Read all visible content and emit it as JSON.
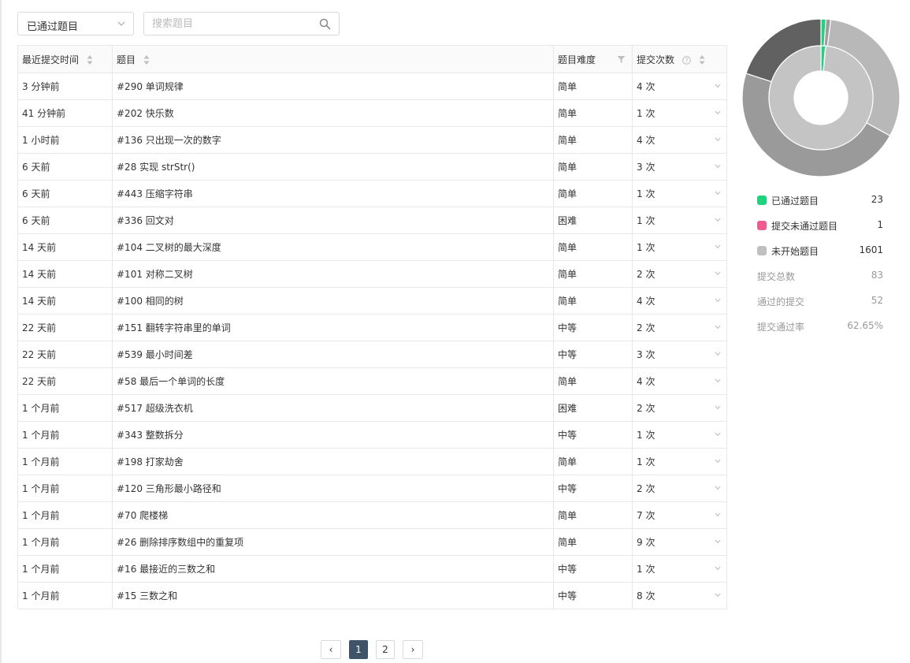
{
  "filter": {
    "selected": "已通过题目"
  },
  "search": {
    "placeholder": "搜索题目"
  },
  "table": {
    "headers": {
      "time": "最近提交时间",
      "title": "题目",
      "difficulty": "题目难度",
      "count": "提交次数"
    },
    "rows": [
      {
        "time": "3 分钟前",
        "title": "#290 单词规律",
        "difficulty": "简单",
        "level": "easy",
        "count": "4 次"
      },
      {
        "time": "41 分钟前",
        "title": "#202 快乐数",
        "difficulty": "简单",
        "level": "easy",
        "count": "1 次"
      },
      {
        "time": "1 小时前",
        "title": "#136 只出现一次的数字",
        "difficulty": "简单",
        "level": "easy",
        "count": "4 次"
      },
      {
        "time": "6 天前",
        "title": "#28 实现 strStr()",
        "difficulty": "简单",
        "level": "easy",
        "count": "3 次"
      },
      {
        "time": "6 天前",
        "title": "#443 压缩字符串",
        "difficulty": "简单",
        "level": "easy",
        "count": "1 次"
      },
      {
        "time": "6 天前",
        "title": "#336 回文对",
        "difficulty": "困难",
        "level": "hard",
        "count": "1 次"
      },
      {
        "time": "14 天前",
        "title": "#104 二叉树的最大深度",
        "difficulty": "简单",
        "level": "easy",
        "count": "1 次"
      },
      {
        "time": "14 天前",
        "title": "#101 对称二叉树",
        "difficulty": "简单",
        "level": "easy",
        "count": "2 次"
      },
      {
        "time": "14 天前",
        "title": "#100 相同的树",
        "difficulty": "简单",
        "level": "easy",
        "count": "4 次"
      },
      {
        "time": "22 天前",
        "title": "#151 翻转字符串里的单词",
        "difficulty": "中等",
        "level": "mid",
        "count": "2 次"
      },
      {
        "time": "22 天前",
        "title": "#539 最小时间差",
        "difficulty": "中等",
        "level": "mid",
        "count": "3 次"
      },
      {
        "time": "22 天前",
        "title": "#58 最后一个单词的长度",
        "difficulty": "简单",
        "level": "easy",
        "count": "4 次"
      },
      {
        "time": "1 个月前",
        "title": "#517 超级洗衣机",
        "difficulty": "困难",
        "level": "hard",
        "count": "2 次"
      },
      {
        "time": "1 个月前",
        "title": "#343 整数拆分",
        "difficulty": "中等",
        "level": "mid",
        "count": "1 次"
      },
      {
        "time": "1 个月前",
        "title": "#198 打家劫舍",
        "difficulty": "简单",
        "level": "easy",
        "count": "1 次"
      },
      {
        "time": "1 个月前",
        "title": "#120 三角形最小路径和",
        "difficulty": "中等",
        "level": "mid",
        "count": "2 次"
      },
      {
        "time": "1 个月前",
        "title": "#70 爬楼梯",
        "difficulty": "简单",
        "level": "easy",
        "count": "7 次"
      },
      {
        "time": "1 个月前",
        "title": "#26 删除排序数组中的重复项",
        "difficulty": "简单",
        "level": "easy",
        "count": "9 次"
      },
      {
        "time": "1 个月前",
        "title": "#16 最接近的三数之和",
        "difficulty": "中等",
        "level": "mid",
        "count": "1 次"
      },
      {
        "time": "1 个月前",
        "title": "#15 三数之和",
        "difficulty": "中等",
        "level": "mid",
        "count": "8 次"
      }
    ]
  },
  "pagination": {
    "prev": "‹",
    "pages": [
      "1",
      "2"
    ],
    "current": "1",
    "next": "›"
  },
  "summary": {
    "legend": [
      {
        "label": "已通过题目",
        "value": "23",
        "color": "#1fd27c"
      },
      {
        "label": "提交未通过题目",
        "value": "1",
        "color": "#ef5b8f"
      },
      {
        "label": "未开始题目",
        "value": "1601",
        "color": "#bfbfbf"
      }
    ],
    "stats": [
      {
        "label": "提交总数",
        "value": "83"
      },
      {
        "label": "通过的提交",
        "value": "52"
      },
      {
        "label": "提交通过率",
        "value": "62.65%"
      }
    ]
  },
  "chart_data": {
    "type": "pie",
    "rings": [
      {
        "ring": "outer",
        "slices": [
          {
            "value": 1,
            "color": "#1fd27c"
          },
          {
            "value": 1,
            "color": "#9e9e9e"
          },
          {
            "value": 31,
            "color": "#b8b8b8"
          },
          {
            "value": 47,
            "color": "#9a9a9a"
          },
          {
            "value": 20,
            "color": "#616161"
          }
        ]
      },
      {
        "ring": "inner",
        "slices": [
          {
            "value": 1.4,
            "color": "#1fd27c"
          },
          {
            "value": 0.1,
            "color": "#ef5b8f"
          },
          {
            "value": 98.5,
            "color": "#c4c4c4"
          }
        ]
      }
    ]
  }
}
